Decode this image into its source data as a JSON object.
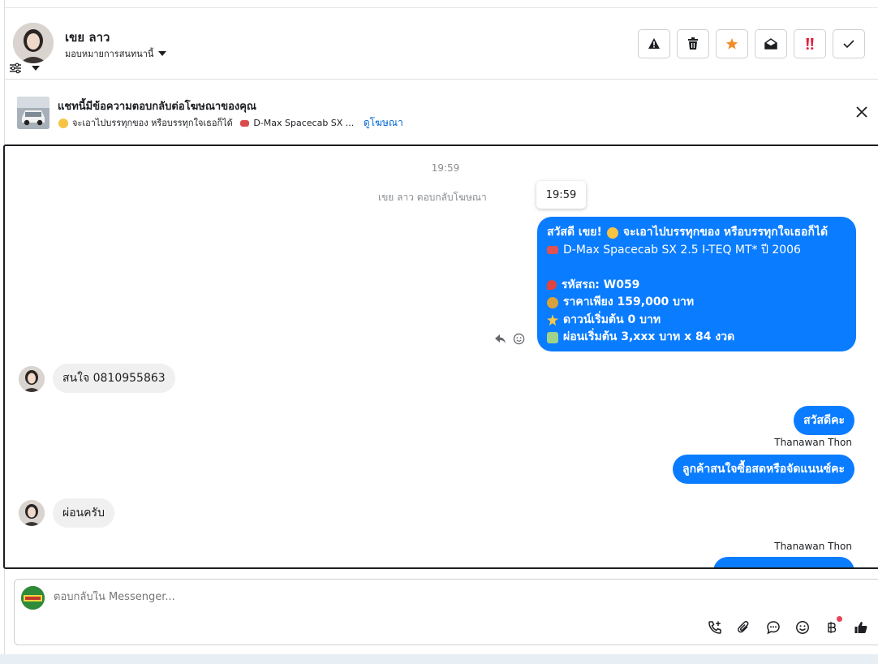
{
  "header": {
    "contact_name": "เขย ลาว",
    "assign_label": "มอบหมายการสนทนานี้"
  },
  "banner": {
    "title": "แชทนี้มีข้อความตอบกลับต่อโฆษณาของคุณ",
    "subtitle": "จะเอาไปบรรทุกของ หรือบรรทุกใจเธอก็ได้",
    "car_snippet": "D-Max Spacecab SX ...",
    "link": "ดูโฆษณา"
  },
  "chat": {
    "timestamp": "19:59",
    "system_message": "เขย ลาว ตอบกลับโฆษณา",
    "tooltip_time": "19:59",
    "ad_message": {
      "line1": "สวัสดี เขย! 😎 จะเอาไปบรรทุกของ หรือบรรทุกใจเธอก็ได้",
      "line1_text_a": "สวัสดี เขย!",
      "line1_text_b": "จะเอาไปบรรทุกของ หรือบรรทุกใจเธอก็ได้",
      "line2": "D-Max Spacecab SX 2.5 I-TEQ MT* ปี 2006",
      "line3": "รหัสรถ: W059",
      "line4": "ราคาเพียง 159,000 บาท",
      "line5": "ดาวน์เริ่มต้น 0 บาท",
      "line6": "ผ่อนเริ่มต้น 3,xxx บาท x 84 งวด"
    },
    "msg_in_1": "สนใจ 0810955863",
    "msg_out_1": "สวัสดีคะ",
    "sender_1": "Thanawan Thon",
    "msg_out_2": "ลูกค้าสนใจซื้อสดหรือจัดแนนซ์คะ",
    "msg_in_2": "ผ่อนครับ",
    "sender_2": "Thanawan Thon"
  },
  "composer": {
    "placeholder": "ตอบกลับใน Messenger..."
  },
  "colors": {
    "accent": "#0a7cff",
    "link": "#0064d1",
    "star": "#f28c28",
    "alert": "#e41e3f"
  },
  "icons": [
    "filter-icon",
    "warning-icon",
    "trash-icon",
    "star-icon",
    "envelope-open-icon",
    "priority-icon",
    "check-icon",
    "close-icon",
    "reply-icon",
    "emoji-icon",
    "call-add-icon",
    "attachment-icon",
    "chat-bubble-icon",
    "smiley-icon",
    "baht-icon",
    "thumbs-up-icon"
  ]
}
